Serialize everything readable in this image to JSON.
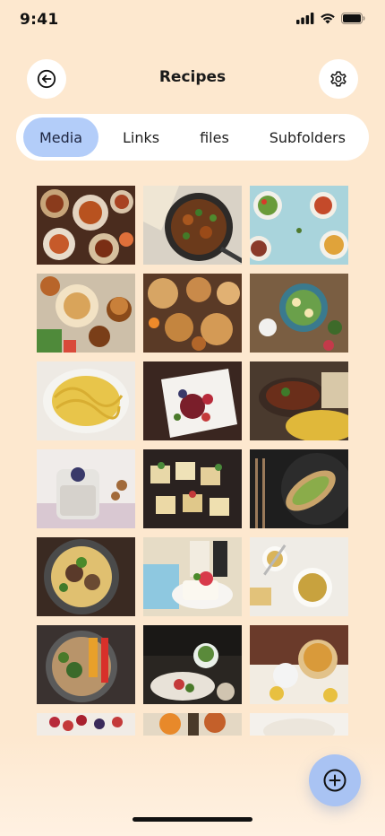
{
  "status_bar": {
    "time": "9:41",
    "icons": [
      "signal-icon",
      "wifi-icon",
      "battery-icon"
    ]
  },
  "header": {
    "title": "Recipes",
    "back_icon": "back-arrow-icon",
    "settings_icon": "gear-icon"
  },
  "tabs": [
    {
      "label": "Media",
      "active": true
    },
    {
      "label": "Links",
      "active": false
    },
    {
      "label": "files",
      "active": false
    },
    {
      "label": "Subfolders",
      "active": false
    }
  ],
  "media": [
    {
      "photo": "food-spread-table"
    },
    {
      "photo": "stir-fry-pan"
    },
    {
      "photo": "salad-plates-blue"
    },
    {
      "photo": "burgers-table"
    },
    {
      "photo": "pies-table"
    },
    {
      "photo": "egg-salad-bowl"
    },
    {
      "photo": "spaghetti-carbonara"
    },
    {
      "photo": "berry-dessert"
    },
    {
      "photo": "curry-rice"
    },
    {
      "photo": "chia-pudding"
    },
    {
      "photo": "canapes"
    },
    {
      "photo": "avocado-toast"
    },
    {
      "photo": "ramen-bowl"
    },
    {
      "photo": "cake-slice"
    },
    {
      "photo": "soup-bowls"
    },
    {
      "photo": "rice-vegetables"
    },
    {
      "photo": "green-sauce-plate"
    },
    {
      "photo": "pasta-cooking"
    },
    {
      "photo": "berries"
    },
    {
      "photo": "orange-dish"
    },
    {
      "photo": "white-plate"
    }
  ],
  "colors": {
    "background": "#fde8cf",
    "accent": "#b3cdf9",
    "fab": "#a9c3f3"
  },
  "fab": {
    "icon": "add-circle-icon"
  }
}
